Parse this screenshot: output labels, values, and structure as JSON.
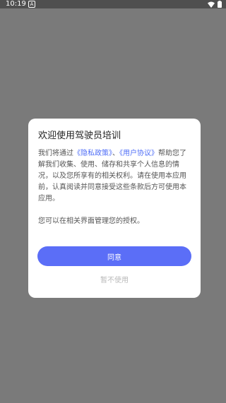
{
  "status_bar": {
    "time": "10:19",
    "app_icon_letter": "A"
  },
  "dialog": {
    "title": "欢迎使用驾驶员培训",
    "body": {
      "part1": "我们将通过",
      "privacy_link": "《隐私政策》",
      "separator": "、",
      "agreement_link": "《用户协议》",
      "part2": "帮助您了解我们收集、使用、储存和共享个人信息的情况，以及您所享有的相关权利。请在使用本应用前，认真阅读并同意接受这些条款后方可使用本应用。"
    },
    "note": "您可以在相关界面管理您的授权。",
    "agree_label": "同意",
    "decline_label": "暂不使用"
  },
  "colors": {
    "overlay": "#7a7a7a",
    "status_bar": "#4f4f4f",
    "accent": "#5b6ef7",
    "link": "#4f6ef7"
  }
}
